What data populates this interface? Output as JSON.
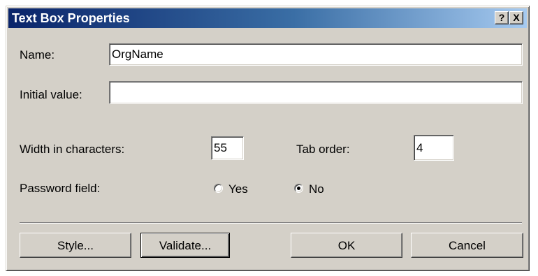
{
  "dialog": {
    "title": "Text Box Properties",
    "help_button": "?",
    "close_button": "X",
    "colors": {
      "title_bar_start": "#0a246a",
      "title_bar_end": "#a6caf0",
      "face": "#d4d0c8"
    }
  },
  "fields": {
    "name_label": "Name:",
    "name_value": "OrgName",
    "initial_value_label": "Initial value:",
    "initial_value_value": "",
    "width_label": "Width in characters:",
    "width_value": "55",
    "tab_order_label": "Tab order:",
    "tab_order_value": "4",
    "password_label": "Password field:",
    "password_options": [
      {
        "label": "Yes",
        "selected": false
      },
      {
        "label": "No",
        "selected": true
      }
    ]
  },
  "buttons": {
    "style": "Style...",
    "validate": "Validate...",
    "ok": "OK",
    "cancel": "Cancel"
  }
}
